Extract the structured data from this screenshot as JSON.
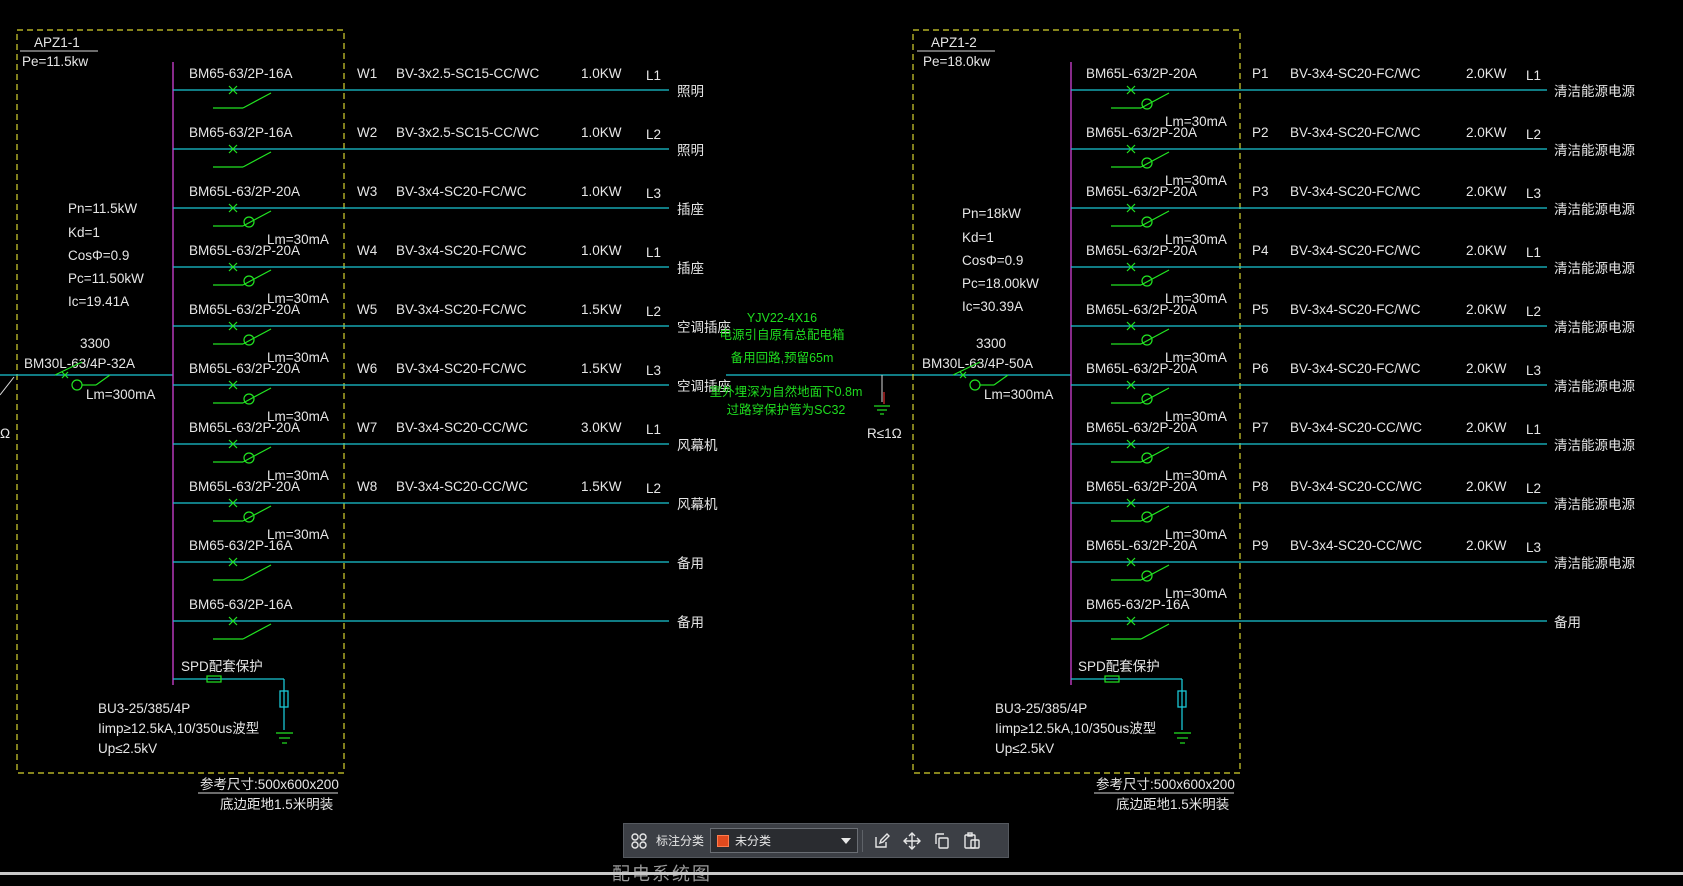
{
  "panels": [
    {
      "id": "APZ1-1",
      "pe": "Pe=11.5kw",
      "calc": [
        "Pn=11.5kW",
        "Kd=1",
        "CosΦ=0.9",
        "Pc=11.50kW",
        "Ic=19.41A"
      ],
      "main_code": "3300",
      "main_breaker": "BM30L-63/4P-32A",
      "main_rcd": "Lm=300mA",
      "circuits": [
        {
          "breaker": "BM65-63/2P-16A",
          "rcd": "",
          "num": "W1",
          "cable": "BV-3x2.5-SC15-CC/WC",
          "power": "1.0KW",
          "phase": "L1",
          "load": "照明"
        },
        {
          "breaker": "BM65-63/2P-16A",
          "rcd": "",
          "num": "W2",
          "cable": "BV-3x2.5-SC15-CC/WC",
          "power": "1.0KW",
          "phase": "L2",
          "load": "照明"
        },
        {
          "breaker": "BM65L-63/2P-20A",
          "rcd": "Lm=30mA",
          "num": "W3",
          "cable": "BV-3x4-SC20-FC/WC",
          "power": "1.0KW",
          "phase": "L3",
          "load": "插座"
        },
        {
          "breaker": "BM65L-63/2P-20A",
          "rcd": "Lm=30mA",
          "num": "W4",
          "cable": "BV-3x4-SC20-FC/WC",
          "power": "1.0KW",
          "phase": "L1",
          "load": "插座"
        },
        {
          "breaker": "BM65L-63/2P-20A",
          "rcd": "Lm=30mA",
          "num": "W5",
          "cable": "BV-3x4-SC20-FC/WC",
          "power": "1.5KW",
          "phase": "L2",
          "load": "空调插座"
        },
        {
          "breaker": "BM65L-63/2P-20A",
          "rcd": "Lm=30mA",
          "num": "W6",
          "cable": "BV-3x4-SC20-FC/WC",
          "power": "1.5KW",
          "phase": "L3",
          "load": "空调插座"
        },
        {
          "breaker": "BM65L-63/2P-20A",
          "rcd": "Lm=30mA",
          "num": "W7",
          "cable": "BV-3x4-SC20-CC/WC",
          "power": "3.0KW",
          "phase": "L1",
          "load": "风幕机"
        },
        {
          "breaker": "BM65L-63/2P-20A",
          "rcd": "Lm=30mA",
          "num": "W8",
          "cable": "BV-3x4-SC20-CC/WC",
          "power": "1.5KW",
          "phase": "L2",
          "load": "风幕机"
        },
        {
          "breaker": "BM65-63/2P-16A",
          "rcd": "",
          "num": "",
          "cable": "",
          "power": "",
          "phase": "",
          "load": "备用"
        },
        {
          "breaker": "BM65-63/2P-16A",
          "rcd": "",
          "num": "",
          "cable": "",
          "power": "",
          "phase": "",
          "load": "备用"
        }
      ],
      "spd_label": "SPD配套保护",
      "spd_specs": [
        "BU3-25/385/4P",
        "Iimp≥12.5kA,10/350us波型",
        "Up≤2.5kV"
      ],
      "ref_size": "参考尺寸:500x600x200",
      "mount": "底边距地1.5米明装"
    },
    {
      "id": "APZ1-2",
      "pe": "Pe=18.0kw",
      "calc": [
        "Pn=18kW",
        "Kd=1",
        "CosΦ=0.9",
        "Pc=18.00kW",
        "Ic=30.39A"
      ],
      "main_code": "3300",
      "main_breaker": "BM30L-63/4P-50A",
      "main_rcd": "Lm=300mA",
      "circuits": [
        {
          "breaker": "BM65L-63/2P-20A",
          "rcd": "Lm=30mA",
          "num": "P1",
          "cable": "BV-3x4-SC20-FC/WC",
          "power": "2.0KW",
          "phase": "L1",
          "load": "清洁能源电源"
        },
        {
          "breaker": "BM65L-63/2P-20A",
          "rcd": "Lm=30mA",
          "num": "P2",
          "cable": "BV-3x4-SC20-FC/WC",
          "power": "2.0KW",
          "phase": "L2",
          "load": "清洁能源电源"
        },
        {
          "breaker": "BM65L-63/2P-20A",
          "rcd": "Lm=30mA",
          "num": "P3",
          "cable": "BV-3x4-SC20-FC/WC",
          "power": "2.0KW",
          "phase": "L3",
          "load": "清洁能源电源"
        },
        {
          "breaker": "BM65L-63/2P-20A",
          "rcd": "Lm=30mA",
          "num": "P4",
          "cable": "BV-3x4-SC20-FC/WC",
          "power": "2.0KW",
          "phase": "L1",
          "load": "清洁能源电源"
        },
        {
          "breaker": "BM65L-63/2P-20A",
          "rcd": "Lm=30mA",
          "num": "P5",
          "cable": "BV-3x4-SC20-FC/WC",
          "power": "2.0KW",
          "phase": "L2",
          "load": "清洁能源电源"
        },
        {
          "breaker": "BM65L-63/2P-20A",
          "rcd": "Lm=30mA",
          "num": "P6",
          "cable": "BV-3x4-SC20-FC/WC",
          "power": "2.0KW",
          "phase": "L3",
          "load": "清洁能源电源"
        },
        {
          "breaker": "BM65L-63/2P-20A",
          "rcd": "Lm=30mA",
          "num": "P7",
          "cable": "BV-3x4-SC20-CC/WC",
          "power": "2.0KW",
          "phase": "L1",
          "load": "清洁能源电源"
        },
        {
          "breaker": "BM65L-63/2P-20A",
          "rcd": "Lm=30mA",
          "num": "P8",
          "cable": "BV-3x4-SC20-CC/WC",
          "power": "2.0KW",
          "phase": "L2",
          "load": "清洁能源电源"
        },
        {
          "breaker": "BM65L-63/2P-20A",
          "rcd": "Lm=30mA",
          "num": "P9",
          "cable": "BV-3x4-SC20-CC/WC",
          "power": "2.0KW",
          "phase": "L3",
          "load": "清洁能源电源"
        },
        {
          "breaker": "BM65-63/2P-16A",
          "rcd": "",
          "num": "",
          "cable": "",
          "power": "",
          "phase": "",
          "load": "备用"
        }
      ],
      "spd_label": "SPD配套保护",
      "spd_specs": [
        "BU3-25/385/4P",
        "Iimp≥12.5kA,10/350us波型",
        "Up≤2.5kV"
      ],
      "ref_size": "参考尺寸:500x600x200",
      "mount": "底边距地1.5米明装"
    }
  ],
  "feeder": {
    "notes_top": [
      "YJV22-4X16",
      "电源引自原有总配电箱",
      "备用回路,预留65m"
    ],
    "notes_bottom": [
      "室外埋深为自然地面下0.8m",
      "过路穿保护管为SC32"
    ],
    "ground": "R≤1Ω",
    "left_edge_fragment": "Ω"
  },
  "toolbar": {
    "label": "标注分类",
    "selected": "未分类",
    "swatch_color": "#e04a1e",
    "icons": [
      "grid-icon",
      "edit-icon",
      "move-icon",
      "copy-icon",
      "paste-icon"
    ]
  },
  "bottom_fragment": "配电系统图",
  "colors": {
    "feeder": "#19c6d4",
    "busbar": "#c13cc6",
    "breaker": "#22e422",
    "panel_border": "#d6d22e",
    "text": "#e6e6e6",
    "note_text": "#1fdc1f"
  }
}
